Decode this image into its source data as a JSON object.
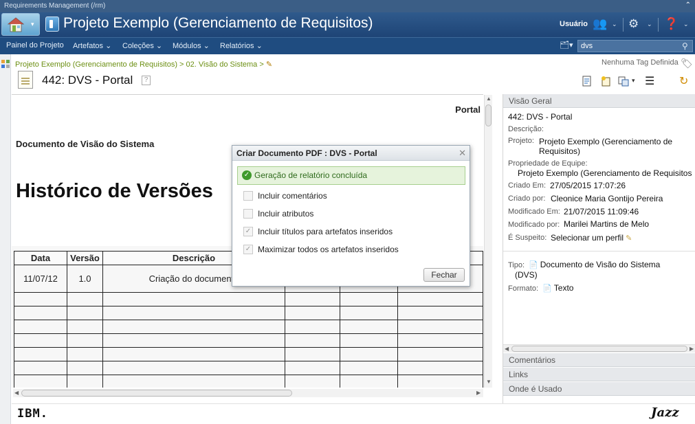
{
  "app": {
    "name": "Requirements Management (/rm)",
    "collapse_icon": "collapse-icon"
  },
  "banner": {
    "project_title": "Projeto Exemplo (Gerenciamento de Requisitos)",
    "user_label": "Usuário"
  },
  "nav": {
    "items": [
      "Painel do Projeto",
      "Artefatos",
      "Coleções",
      "Módulos",
      "Relatórios"
    ],
    "search_value": "dvs"
  },
  "artifact": {
    "breadcrumb": "Projeto Exemplo (Gerenciamento de Requisitos) > 02. Visão do Sistema >",
    "title": "442: DVS - Portal",
    "tag_status": "Nenhuma Tag Definida"
  },
  "content": {
    "portal_label": "Portal",
    "doc_name": "Documento de Visão do Sistema",
    "history_heading": "Histórico de Versões",
    "table": {
      "headers": [
        "Data",
        "Versão",
        "Descrição",
        "",
        "",
        ""
      ],
      "rows": [
        [
          "11/07/12",
          "1.0",
          "Criação do documento",
          "",
          "",
          ""
        ]
      ]
    }
  },
  "dialog": {
    "title": "Criar Documento PDF : DVS - Portal",
    "message": "Geração de relatório concluída",
    "options": [
      {
        "label": "Incluir comentários",
        "checked": false
      },
      {
        "label": "Incluir atributos",
        "checked": false
      },
      {
        "label": "Incluir títulos para artefatos inseridos",
        "checked": true
      },
      {
        "label": "Maximizar todos os artefatos inseridos",
        "checked": true
      }
    ],
    "close_label": "Fechar"
  },
  "side": {
    "overview_title": "Visão Geral",
    "artifact_name": "442: DVS - Portal",
    "description_label": "Descrição:",
    "project_label": "Projeto:",
    "project_value_1": "Projeto Exemplo (Gerenciamento de",
    "project_value_2": "Requisitos)",
    "team_label": "Propriedade de Equipe:",
    "team_value": "Projeto Exemplo (Gerenciamento de Requisitos",
    "created_on_label": "Criado Em:",
    "created_on": "27/05/2015 17:07:26",
    "created_by_label": "Criado por:",
    "created_by": "Cleonice Maria Gontijo Pereira",
    "modified_on_label": "Modificado Em:",
    "modified_on": "21/07/2015 11:09:46",
    "modified_by_label": "Modificado por:",
    "modified_by": "Marilei Martins de Melo",
    "suspect_label": "É Suspeito:",
    "suspect_value": "Selecionar um perfil",
    "type_label": "Tipo:",
    "type_value_1": "Documento de Visão do Sistema",
    "type_value_2": "(DVS)",
    "format_label": "Formato:",
    "format_value": "Texto",
    "comments_title": "Comentários",
    "links_title": "Links",
    "where_used_title": "Onde é Usado"
  },
  "footer": {
    "left_logo": "IBM.",
    "right_logo": "Jazz"
  }
}
